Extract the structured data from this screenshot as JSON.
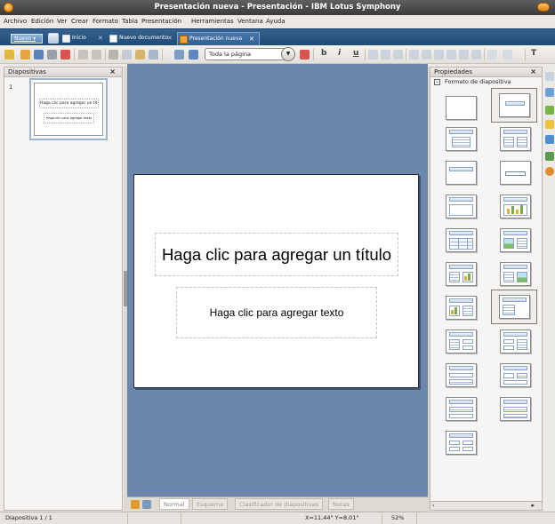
{
  "window": {
    "title": "Presentación nueva - Presentación - IBM Lotus Symphony"
  },
  "menubar": [
    "Archivo",
    "Edición",
    "Ver",
    "Crear",
    "Formato",
    "Tabla",
    "Presentación",
    "Herramientas",
    "Ventana",
    "Ayuda"
  ],
  "tabbar": {
    "new_button": "Nuevo",
    "tabs": [
      {
        "label": "Inicio",
        "active": false,
        "icon": "home-icon"
      },
      {
        "label": "Nuevo documento",
        "active": false,
        "icon": "document-icon"
      },
      {
        "label": "Presentación nueva",
        "active": true,
        "icon": "presentation-icon"
      }
    ]
  },
  "toolbar": {
    "zoom_value": "Toda la página",
    "bold": "b",
    "italic": "i",
    "underline": "u",
    "text_tool": "T"
  },
  "left_pane": {
    "title": "Diapositivas",
    "slide_number": "1",
    "thumb_title": "Haga clic para agregar un título",
    "thumb_text": "Haga clic para agregar texto"
  },
  "slide": {
    "title_placeholder": "Haga clic para agregar un título",
    "text_placeholder": "Haga clic para agregar texto"
  },
  "view_tabs": [
    "Normal",
    "Esquema",
    "Clasificador de diapositivas",
    "Notas"
  ],
  "right_pane": {
    "title": "Propiedades",
    "section": "Formato de diapositiva"
  },
  "statusbar": {
    "slide": "Diapositiva 1 / 1",
    "coords": "X=11,44\" Y=8,01\"",
    "zoom": "52%"
  },
  "colors": {
    "workspace": "#6c87ac",
    "tabbar": "#204a76",
    "accent": "#e67e00"
  }
}
